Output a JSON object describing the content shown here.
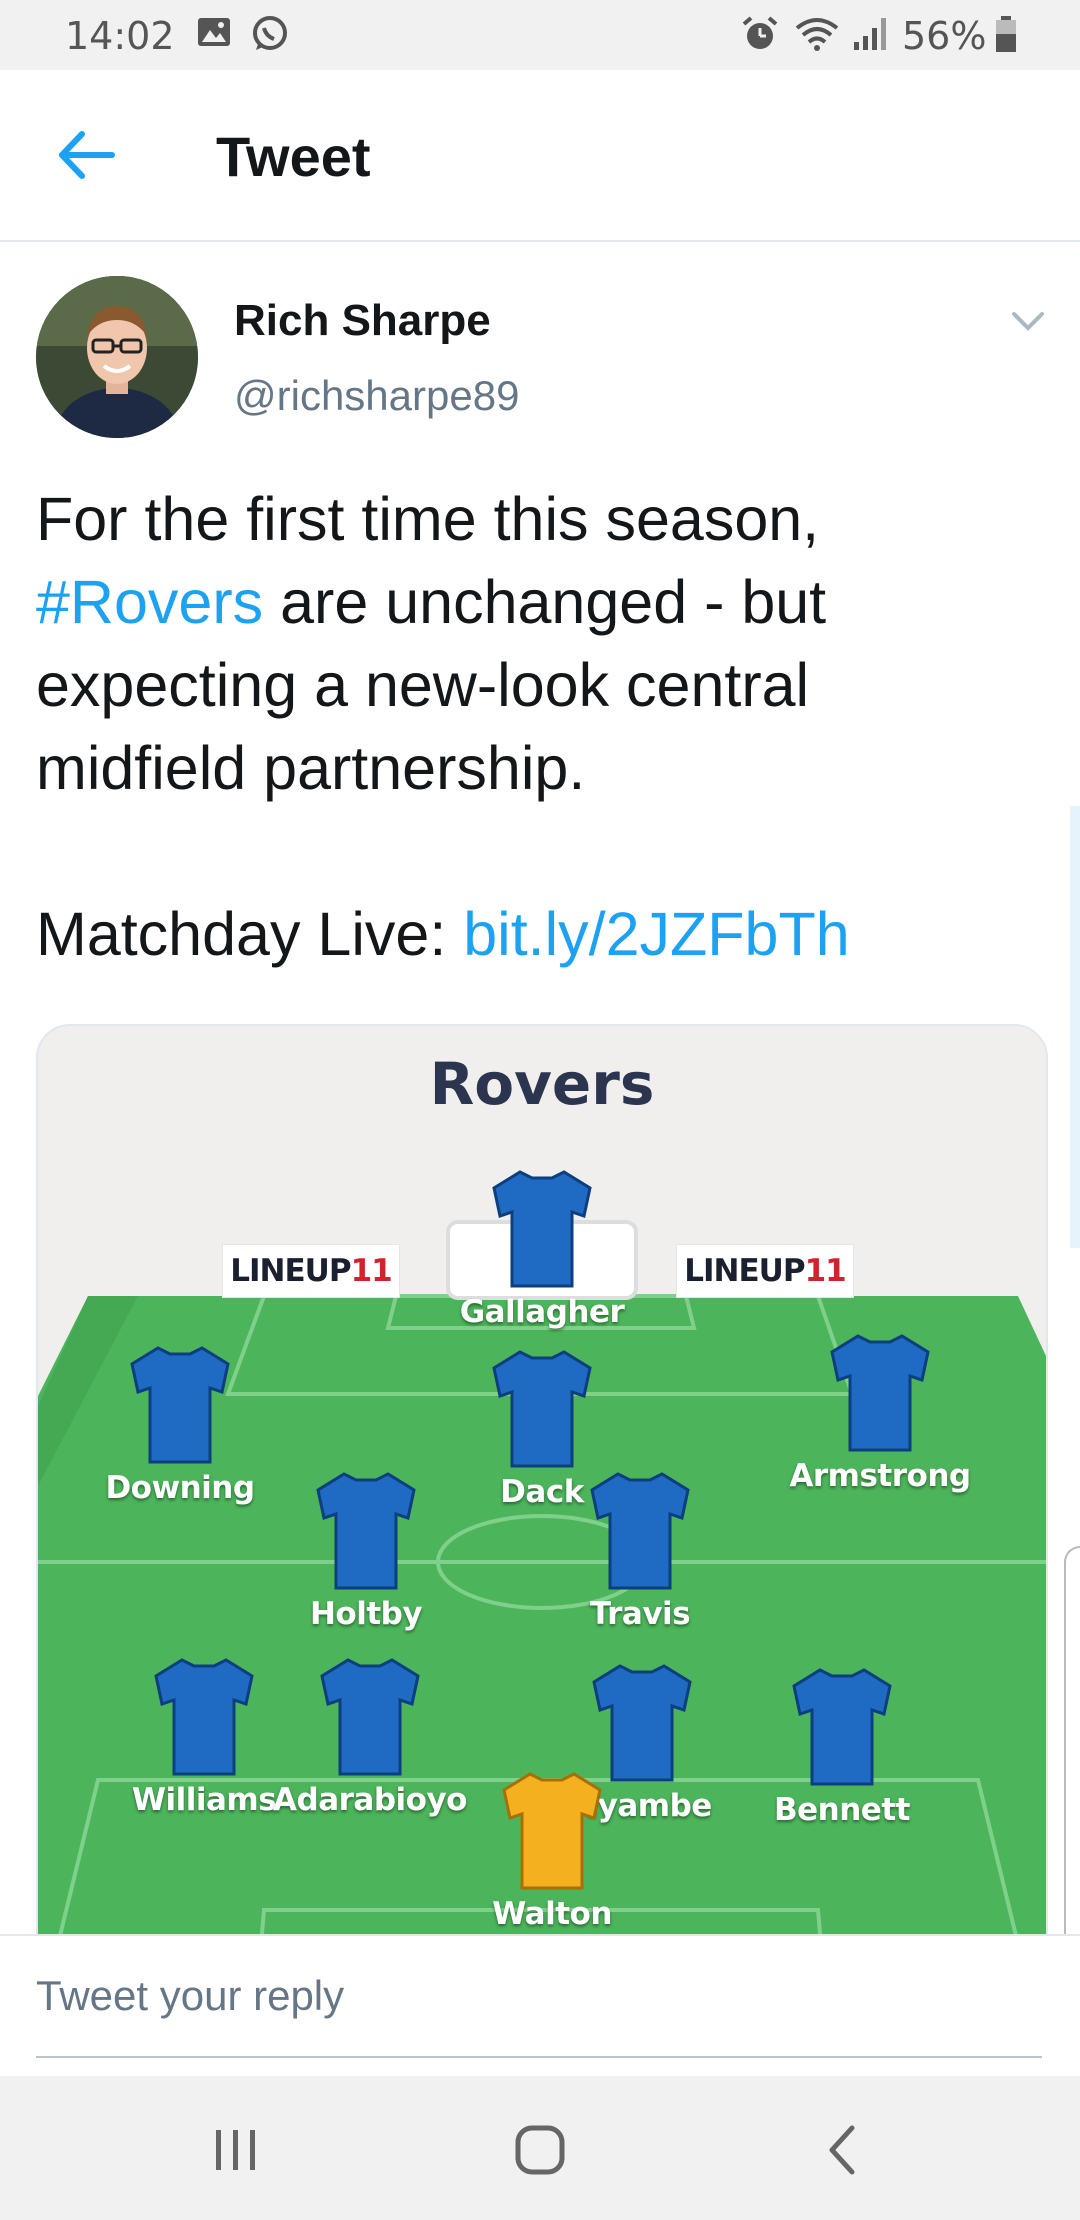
{
  "status_bar": {
    "time": "14:02",
    "battery": "56%"
  },
  "header": {
    "title": "Tweet"
  },
  "author": {
    "name": "Rich Sharpe",
    "handle": "@richsharpe89"
  },
  "tweet": {
    "line1": "For the first time this season,",
    "hashtag": "#Rovers",
    "line2_rest": " are unchanged - but",
    "line3": "expecting a new-look central",
    "line4": "midfield partnership.",
    "live_label": "Matchday Live: ",
    "live_link": "bit.ly/2JZFbTh"
  },
  "card": {
    "title": "Rovers",
    "badge_prefix": "LINEUP",
    "badge_suffix": "11",
    "players": {
      "gallagher": "Gallagher",
      "downing": "Downing",
      "dack": "Dack",
      "armstrong": "Armstrong",
      "holtby": "Holtby",
      "travis": "Travis",
      "williams": "Williams",
      "adarabioyo": "Adarabioyo",
      "nyambe": "Nyambe",
      "bennett": "Bennett",
      "walton": "Walton"
    },
    "colors": {
      "pitch": "#4cb55b",
      "shirt": "#1f6bc4",
      "goalkeeper_shirt": "#f5b01f"
    }
  },
  "reply": {
    "placeholder": "Tweet your reply"
  },
  "icons": [
    "image-icon",
    "whatsapp-icon",
    "alarm-icon",
    "wifi-icon",
    "signal-icon",
    "battery-icon",
    "back-arrow-icon",
    "chevron-down-icon",
    "recent-apps-icon",
    "home-icon",
    "back-nav-icon"
  ]
}
